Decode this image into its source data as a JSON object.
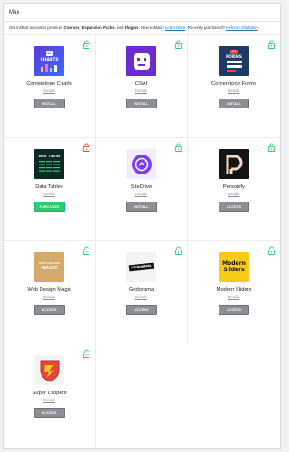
{
  "title": "Max",
  "intro": {
    "prefix": "Get instant access to premium ",
    "courses": "Courses",
    "sep1": ", ",
    "packs": "Expansion Packs",
    "sep2": ", and ",
    "plugins": "Plugins",
    "middle": ". New to Max? ",
    "learn_more": "Learn More",
    "middle2": ". Recently purchased? ",
    "refresh": "Refresh Validation",
    "end": "."
  },
  "details_label": "Details",
  "colors": {
    "locked_green": "#2ecc71",
    "locked_red": "#e8463c",
    "button_grey": "#8c8f94"
  },
  "products": [
    {
      "name": "Cornerstone Charts",
      "button": "INSTALL",
      "lock": "unlocked-green",
      "thumb_text": "CHARTS",
      "thumb_badge": "CS"
    },
    {
      "name": "CSAI",
      "button": "INSTALL",
      "lock": "unlocked-green"
    },
    {
      "name": "Cornerstone Forms",
      "button": "INSTALL",
      "lock": "unlocked-green",
      "thumb_text": "FORMS",
      "thumb_badge": "CS"
    },
    {
      "name": "Data Tables",
      "button": "PURCHASE",
      "lock": "locked-red",
      "thumb_text": "Data Tables"
    },
    {
      "name": "SiteDrive",
      "button": "INSTALL",
      "lock": "unlocked-green"
    },
    {
      "name": "Personify",
      "button": "ACCESS",
      "lock": "unlocked-green"
    },
    {
      "name": "Web Design Magic",
      "button": "ACCESS",
      "lock": "unlocked-green",
      "thumb_text": "WEB DESIGN",
      "thumb_text2": "MAGIC"
    },
    {
      "name": "Gridorama",
      "button": "ACCESS",
      "lock": "unlocked-green",
      "thumb_text": "GRIDORAMA"
    },
    {
      "name": "Modern Sliders",
      "button": "ACCESS",
      "lock": "unlocked-green",
      "thumb_text": "Modern",
      "thumb_text2": "Sliders"
    },
    {
      "name": "Super Loopers",
      "button": "ACCESS",
      "lock": "unlocked-green"
    }
  ]
}
